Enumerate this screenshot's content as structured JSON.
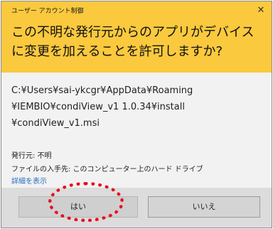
{
  "dialog": {
    "title": "ユーザー アカウント制御",
    "close_glyph": "✕",
    "question": "この不明な発行元からのアプリがデバイスに変更を加えることを許可しますか?",
    "path_lines": [
      "C:¥Users¥sai-ykcgr¥AppData¥Roaming",
      "¥IEMBIO¥condiView_v1 1.0.34¥install",
      "¥condiView_v1.msi"
    ],
    "publisher": "発行元: 不明",
    "origin": "ファイルの入手先: このコンピューター上のハード ドライブ",
    "details_link": "詳細を表示",
    "buttons": {
      "yes": "はい",
      "no": "いいえ"
    }
  },
  "colors": {
    "header": "#fac93e",
    "body": "#f2f2f2",
    "link": "#2a6fbd",
    "annotation": "#e8101d"
  }
}
